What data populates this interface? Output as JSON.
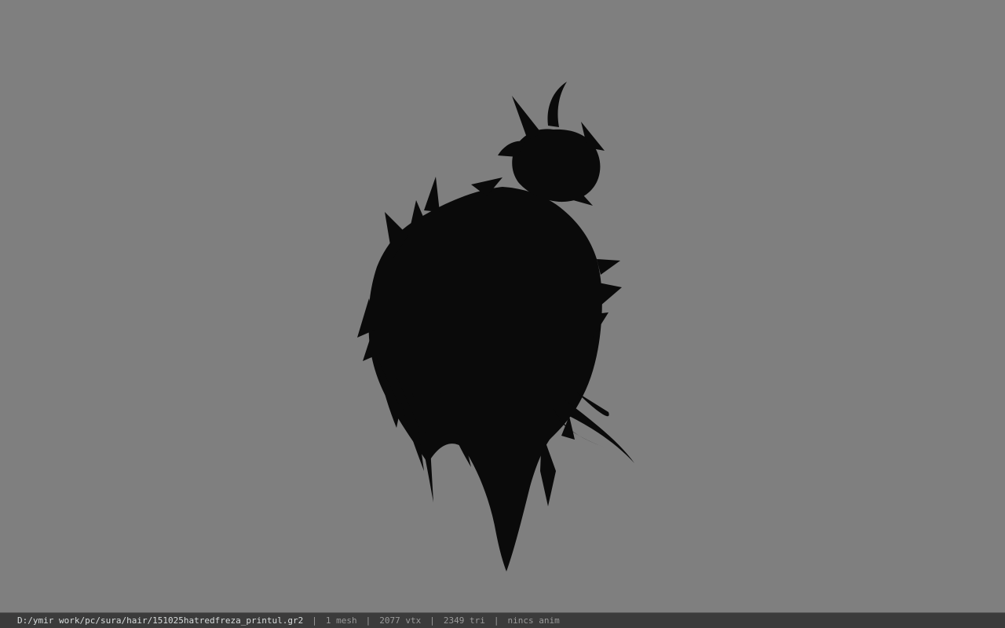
{
  "viewport": {
    "background_color": "#7f7f7f",
    "model_color": "#0a0a0a",
    "model_icon": "hair-mesh-silhouette"
  },
  "status_bar": {
    "file_path": "D:/ymir work/pc/sura/hair/151025hatredfreza_printul.gr2",
    "separator": "|",
    "mesh_count": "1 mesh",
    "vertex_count": "2077 vtx",
    "triangle_count": "2349 tri",
    "animation": "nincs anim"
  }
}
